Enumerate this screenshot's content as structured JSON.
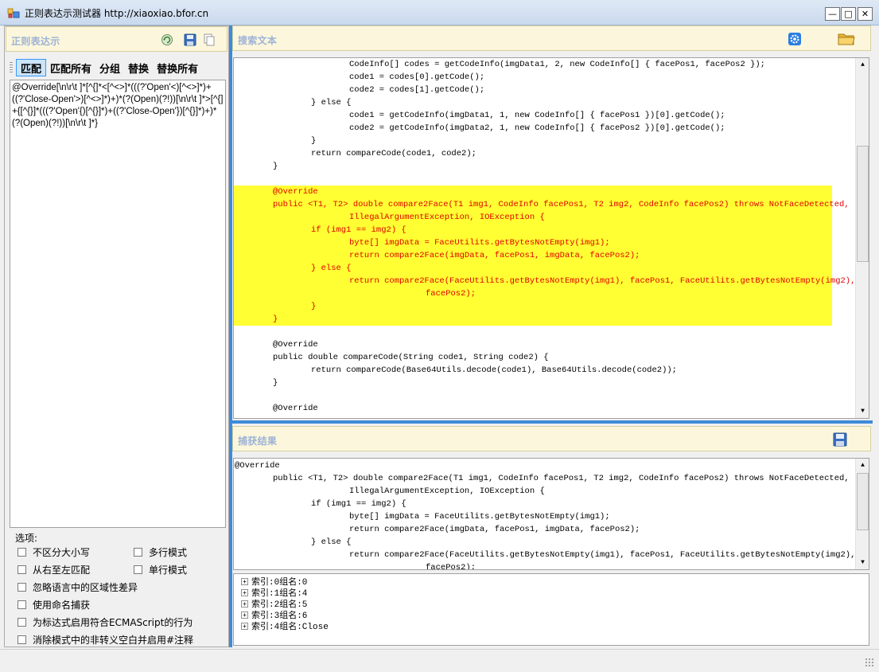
{
  "window": {
    "title": "正则表达示测试器 http://xiaoxiao.bfor.cn",
    "minimize": "—",
    "maximize": "□",
    "close": "✕"
  },
  "regex_panel": {
    "title": "正则表达示",
    "toolbar": [
      "匹配",
      "匹配所有",
      "分组",
      "替换",
      "替换所有"
    ],
    "active_tab": "匹配",
    "pattern": "@Override[\\n\\r\\t ]*[^{]*<[^<>]*(((?'Open'<)[^<>]*)+((?'Close-Open'>)[^<>]*)+)*(?(Open)(?!))[\\n\\r\\t ]*>[^{]+{[^{}]*(((?'Open'{)[^{}]*)+((?'Close-Open'})[^{}]*)+)*(?(Open)(?!))[\\n\\r\\t ]*}"
  },
  "options": {
    "title": "选项:",
    "items": [
      "不区分大小写",
      "多行模式",
      "从右至左匹配",
      "单行模式",
      "忽略语言中的区域性差异",
      "使用命名捕获",
      "为标达式启用符合ECMAScript的行为",
      "消除模式中的非转义空白并启用#注释"
    ]
  },
  "search_panel": {
    "title": "搜索文本",
    "lines": [
      {
        "indent": 2,
        "text": "CodeInfo[] codes = getCodeInfo(imgData1, 2, new CodeInfo[] { facePos1, facePos2 });",
        "hl": false
      },
      {
        "indent": 2,
        "text": "code1 = codes[0].getCode();",
        "hl": false
      },
      {
        "indent": 2,
        "text": "code2 = codes[1].getCode();",
        "hl": false
      },
      {
        "indent": 1,
        "text": "} else {",
        "hl": false
      },
      {
        "indent": 2,
        "text": "code1 = getCodeInfo(imgData1, 1, new CodeInfo[] { facePos1 })[0].getCode();",
        "hl": false
      },
      {
        "indent": 2,
        "text": "code2 = getCodeInfo(imgData2, 1, new CodeInfo[] { facePos2 })[0].getCode();",
        "hl": false
      },
      {
        "indent": 1,
        "text": "}",
        "hl": false
      },
      {
        "indent": 1,
        "text": "return compareCode(code1, code2);",
        "hl": false
      },
      {
        "indent": 0,
        "text": "}",
        "hl": false
      },
      {
        "indent": 0,
        "text": "",
        "hl": false
      },
      {
        "indent": 0,
        "text": "@Override",
        "hl": true
      },
      {
        "indent": 0,
        "text": "public <T1, T2> double compare2Face(T1 img1, CodeInfo facePos1, T2 img2, CodeInfo facePos2) throws NotFaceDetected,",
        "hl": true
      },
      {
        "indent": 2,
        "text": "IllegalArgumentException, IOException {",
        "hl": true
      },
      {
        "indent": 1,
        "text": "if (img1 == img2) {",
        "hl": true
      },
      {
        "indent": 2,
        "text": "byte[] imgData = FaceUtilits.getBytesNotEmpty(img1);",
        "hl": true
      },
      {
        "indent": 2,
        "text": "return compare2Face(imgData, facePos1, imgData, facePos2);",
        "hl": true
      },
      {
        "indent": 1,
        "text": "} else {",
        "hl": true
      },
      {
        "indent": 2,
        "text": "return compare2Face(FaceUtilits.getBytesNotEmpty(img1), facePos1, FaceUtilits.getBytesNotEmpty(img2),",
        "hl": true
      },
      {
        "indent": 4,
        "text": "facePos2);",
        "hl": true
      },
      {
        "indent": 1,
        "text": "}",
        "hl": true
      },
      {
        "indent": 0,
        "text": "}",
        "hl": true
      },
      {
        "indent": 0,
        "text": "",
        "hl": false
      },
      {
        "indent": 0,
        "text": "@Override",
        "hl": false
      },
      {
        "indent": 0,
        "text": "public double compareCode(String code1, String code2) {",
        "hl": false
      },
      {
        "indent": 1,
        "text": "return compareCode(Base64Utils.decode(code1), Base64Utils.decode(code2));",
        "hl": false
      },
      {
        "indent": 0,
        "text": "}",
        "hl": false
      },
      {
        "indent": 0,
        "text": "",
        "hl": false
      },
      {
        "indent": 0,
        "text": "@Override",
        "hl": false
      }
    ]
  },
  "capture_panel": {
    "title": "捕获结果",
    "lines": [
      {
        "indent": 0,
        "text": "@Override"
      },
      {
        "indent": 1,
        "text": "public <T1, T2> double compare2Face(T1 img1, CodeInfo facePos1, T2 img2, CodeInfo facePos2) throws NotFaceDetected,"
      },
      {
        "indent": 3,
        "text": "IllegalArgumentException, IOException {"
      },
      {
        "indent": 2,
        "text": "if (img1 == img2) {"
      },
      {
        "indent": 3,
        "text": "byte[] imgData = FaceUtilits.getBytesNotEmpty(img1);"
      },
      {
        "indent": 3,
        "text": "return compare2Face(imgData, facePos1, imgData, facePos2);"
      },
      {
        "indent": 2,
        "text": "} else {"
      },
      {
        "indent": 3,
        "text": "return compare2Face(FaceUtilits.getBytesNotEmpty(img1), facePos1, FaceUtilits.getBytesNotEmpty(img2),"
      },
      {
        "indent": 5,
        "text": "facePos2);"
      }
    ],
    "groups": [
      "索引:0组名:0",
      "索引:1组名:4",
      "索引:2组名:5",
      "索引:3组名:6",
      "索引:4组名:Close"
    ]
  },
  "colors": {
    "highlight_bg": "#ffff33",
    "highlight_text": "#e00000",
    "splitter": "#3e8bd8",
    "header_bg": "#fcf7dc",
    "header_text": "#9eb2d6"
  }
}
